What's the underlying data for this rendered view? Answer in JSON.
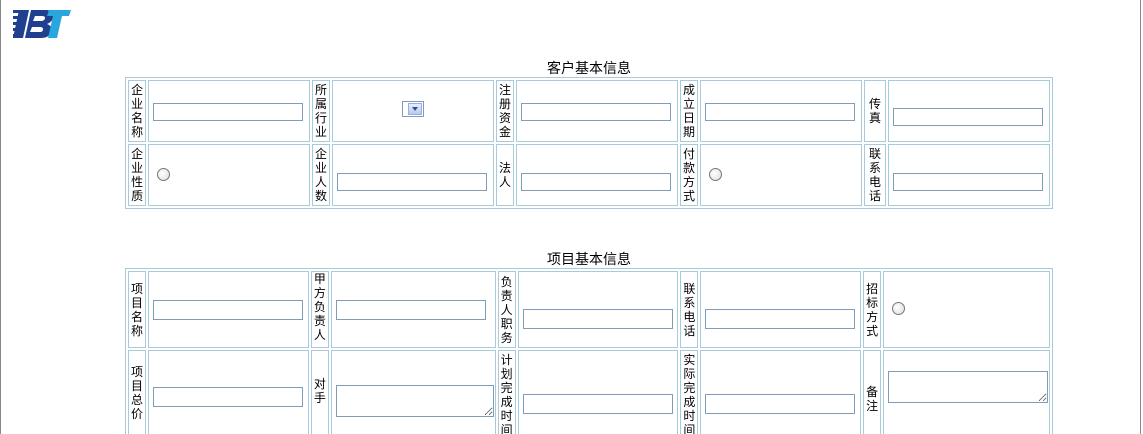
{
  "logo": {
    "text": "IBT"
  },
  "customer_section": {
    "title": "客户基本信息",
    "labels": {
      "company_name": [
        "企",
        "业",
        "名",
        "称"
      ],
      "industry": [
        "所",
        "属",
        "行",
        "业"
      ],
      "registered_capital": [
        "注",
        "册",
        "资",
        "金"
      ],
      "founded_date": [
        "成",
        "立",
        "日",
        "期"
      ],
      "fax": [
        "传",
        "真"
      ],
      "company_nature": [
        "企",
        "业",
        "性",
        "质"
      ],
      "employee_count": [
        "企",
        "业",
        "人",
        "数"
      ],
      "legal_person": [
        "法",
        "人"
      ],
      "payment_method": [
        "付",
        "款",
        "方",
        "式"
      ],
      "contact_phone": [
        "联",
        "系",
        "电",
        "话"
      ]
    },
    "values": {
      "company_name": "",
      "registered_capital": "",
      "founded_date": "",
      "fax": "",
      "employee_count": "",
      "legal_person": "",
      "contact_phone": ""
    }
  },
  "project_section": {
    "title": "项目基本信息",
    "labels": {
      "project_name": [
        "项",
        "目",
        "名",
        "称"
      ],
      "client_manager": [
        "甲",
        "方",
        "负",
        "责",
        "人"
      ],
      "manager_title": [
        "负",
        "责",
        "人",
        "职",
        "务"
      ],
      "contact_phone": [
        "联",
        "系",
        "电",
        "话"
      ],
      "bidding_method": [
        "招",
        "标",
        "方",
        "式"
      ],
      "total_price": [
        "项",
        "目",
        "总",
        "价"
      ],
      "competitor": [
        "对",
        "手"
      ],
      "planned_completion": [
        "计",
        "划",
        "完",
        "成",
        "时",
        "间"
      ],
      "actual_completion": [
        "实",
        "际",
        "完",
        "成",
        "时",
        "间"
      ],
      "remarks": [
        "备",
        "注"
      ]
    },
    "values": {
      "project_name": "",
      "client_manager": "",
      "manager_title": "",
      "contact_phone": "",
      "total_price": "",
      "competitor": "",
      "planned_completion": "",
      "actual_completion": "",
      "remarks": ""
    }
  }
}
